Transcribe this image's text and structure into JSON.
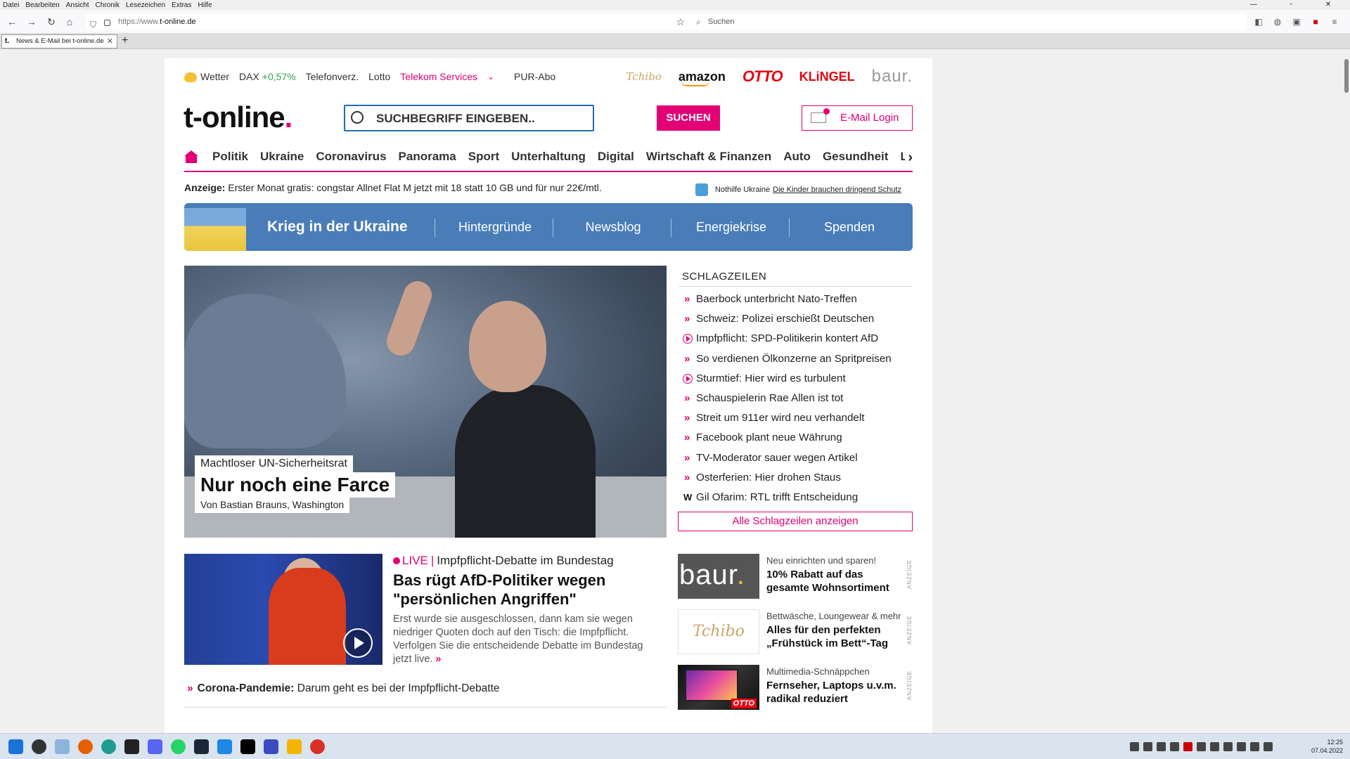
{
  "browser": {
    "menu": [
      "Datei",
      "Bearbeiten",
      "Ansicht",
      "Chronik",
      "Lesezeichen",
      "Extras",
      "Hilfe"
    ],
    "url_prefix": "https://www.",
    "url_domain": "t-online.de",
    "search_placeholder": "Suchen",
    "tab_title": "News & E-Mail bei t-online.de",
    "tab_favicon": "t.",
    "new_tab": "+"
  },
  "topline": {
    "wetter": "Wetter",
    "dax_label": "DAX",
    "dax_value": "+0,57%",
    "telefonverz": "Telefonverz.",
    "lotto": "Lotto",
    "telekom": "Telekom Services",
    "chevron": "⌄",
    "purabo": "PUR-Abo"
  },
  "brands": {
    "tchibo": "Tchibo",
    "amazon": "amazon",
    "otto": "OTTO",
    "klingel": "KLiNGEL",
    "baur": "baur."
  },
  "logo": {
    "text": "t-online",
    "dot": "."
  },
  "search": {
    "placeholder": "SUCHBEGRIFF EINGEBEN..",
    "button": "SUCHEN"
  },
  "mail_login": "E-Mail Login",
  "nav": [
    "Politik",
    "Ukraine",
    "Coronavirus",
    "Panorama",
    "Sport",
    "Unterhaltung",
    "Digital",
    "Wirtschaft & Finanzen",
    "Auto",
    "Gesundheit",
    "Leben"
  ],
  "nav_more": "›",
  "ad_line": {
    "label": "Anzeige:",
    "text": " Erster Monat gratis: congstar Allnet Flat M jetzt mit 18 statt 10 GB und für nur 22€/mtl."
  },
  "nothilfe": {
    "label": "Nothilfe Ukraine",
    "link": "Die Kinder brauchen dringend Schutz"
  },
  "ukraine_bar": {
    "title": "Krieg in der Ukraine",
    "links": [
      "Hintergründe",
      "Newsblog",
      "Energiekrise",
      "Spenden"
    ]
  },
  "hero": {
    "kicker": "Machtloser UN-Sicherheitsrat",
    "headline": "Nur noch eine Farce",
    "author": "Von Bastian Brauns, Washington"
  },
  "schlagzeilen": {
    "title": "SCHLAGZEILEN",
    "items": [
      {
        "text": "Baerbock unterbricht Nato-Treffen",
        "icon": "chevron-icon"
      },
      {
        "text": "Schweiz: Polizei erschießt Deutschen",
        "icon": "chevron-icon"
      },
      {
        "text": "Impfpflicht: SPD-Politikerin kontert AfD",
        "icon": "play-icon"
      },
      {
        "text": "So verdienen Ölkonzerne an Spritpreisen",
        "icon": "chevron-icon"
      },
      {
        "text": "Sturmtief: Hier wird es turbulent",
        "icon": "play-icon"
      },
      {
        "text": "Schauspielerin Rae Allen ist tot",
        "icon": "chevron-icon"
      },
      {
        "text": "Streit um 911er wird neu verhandelt",
        "icon": "chevron-icon"
      },
      {
        "text": "Facebook plant neue Währung",
        "icon": "chevron-icon"
      },
      {
        "text": "TV-Moderator sauer wegen Artikel",
        "icon": "chevron-icon"
      },
      {
        "text": "Osterferien: Hier drohen Staus",
        "icon": "chevron-icon"
      },
      {
        "text": "Gil Ofarim: RTL trifft Entscheidung",
        "icon": "w-icon"
      }
    ],
    "all_button": "Alle Schlagzeilen anzeigen"
  },
  "teaser": {
    "live": "LIVE",
    "kicker": "Impfpflicht-Debatte im Bundestag",
    "headline": "Bas rügt AfD-Politiker wegen \"persönlichen Angriffen\"",
    "text": "Erst wurde sie ausgeschlossen, dann kam sie wegen niedriger Quoten doch auf den Tisch: die Impfpflicht. Verfolgen Sie die entscheidende Debatte im Bundestag jetzt live.",
    "more": "»"
  },
  "related": {
    "topic": "Corona-Pandemie:",
    "text": " Darum geht es bei der Impfpflicht-Debatte"
  },
  "ads": [
    {
      "logo": "baur",
      "logo_dot": ".",
      "kicker": "Neu einrichten und sparen!",
      "title": "10% Rabatt auf das gesamte Wohnsortiment",
      "label": "ANZEIGE"
    },
    {
      "logo": "Tchibo",
      "kicker": "Bettwäsche, Loungewear & mehr",
      "title": "Alles für den perfekten „Frühstück im Bett“-Tag",
      "label": "ANZEIGE"
    },
    {
      "logo": "OTTO",
      "kicker": "Multimedia-Schnäppchen",
      "title": "Fernseher, Laptops u.v.m. radikal reduziert",
      "label": "ANZEIGE"
    }
  ],
  "clock": {
    "time": "12:25",
    "date": "07.04.2022"
  },
  "colors": {
    "magenta": "#e20074",
    "ukraine_blue": "#4a7db8",
    "search_border": "#1f6eb5"
  }
}
